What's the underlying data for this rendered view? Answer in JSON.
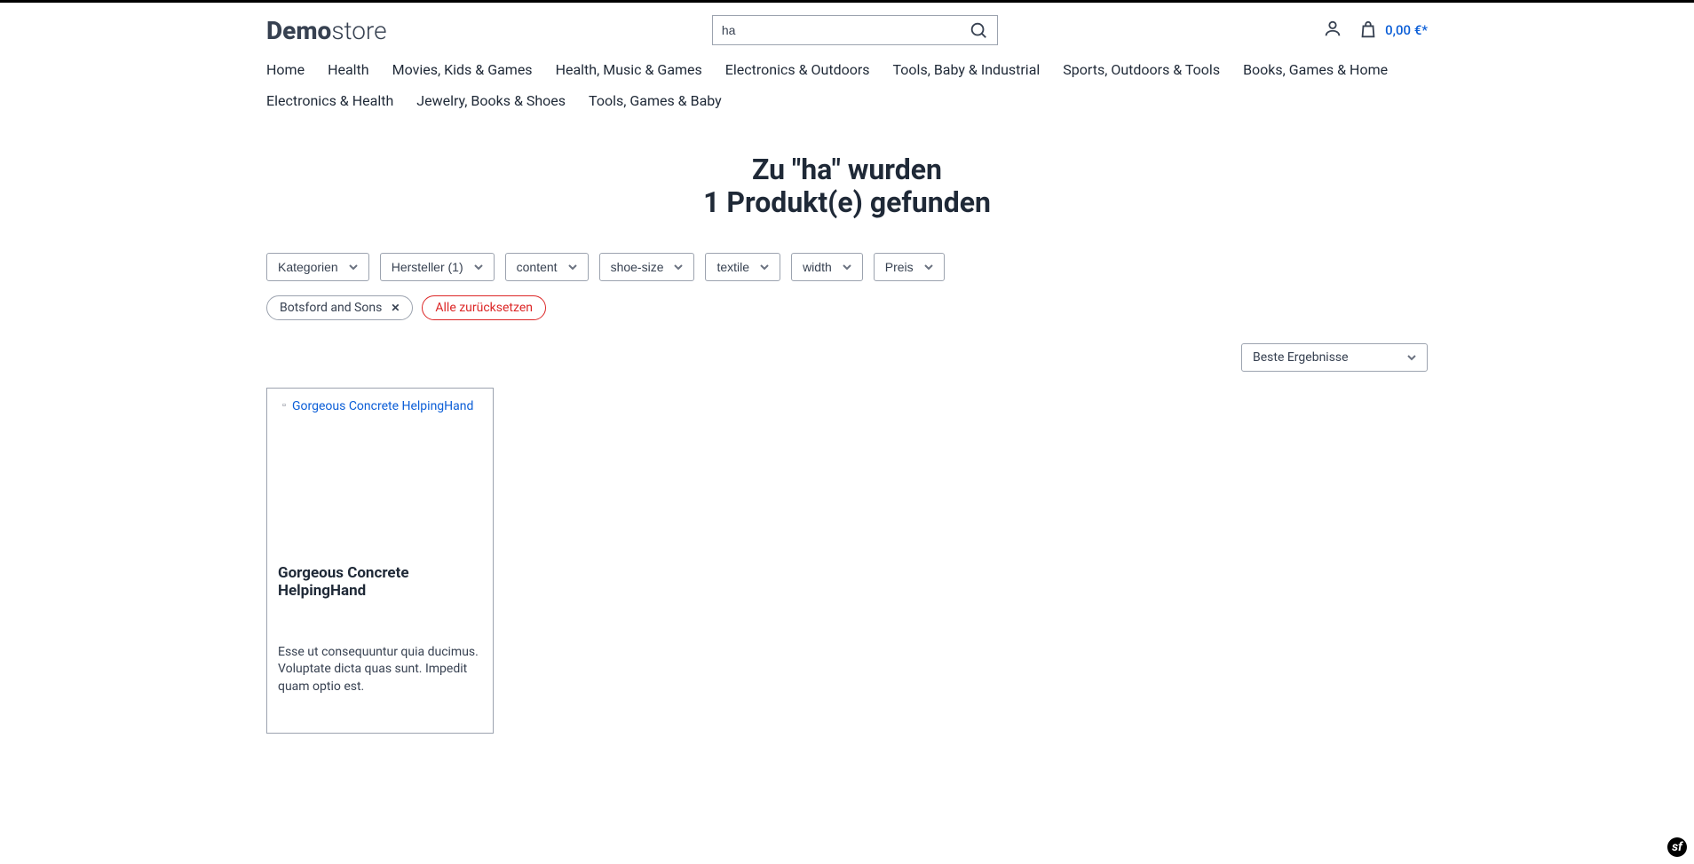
{
  "logo": {
    "bold": "Demo",
    "light": "store"
  },
  "search": {
    "value": "ha"
  },
  "cart": {
    "total": "0,00 €*"
  },
  "nav": [
    "Home",
    "Health",
    "Movies, Kids & Games",
    "Health, Music & Games",
    "Electronics & Outdoors",
    "Tools, Baby & Industrial",
    "Sports, Outdoors & Tools",
    "Books, Games & Home",
    "Electronics & Health",
    "Jewelry, Books & Shoes",
    "Tools, Games & Baby"
  ],
  "title_line1": "Zu \"ha\" wurden",
  "title_line2": "1 Produkt(e) gefunden",
  "filters": [
    {
      "label": "Kategorien",
      "count": ""
    },
    {
      "label": "Hersteller",
      "count": "(1)"
    },
    {
      "label": "content",
      "count": ""
    },
    {
      "label": "shoe-size",
      "count": ""
    },
    {
      "label": "textile",
      "count": ""
    },
    {
      "label": "width",
      "count": ""
    },
    {
      "label": "Preis",
      "count": ""
    }
  ],
  "active_filters": {
    "chip_label": "Botsford and Sons",
    "reset_label": "Alle zurücksetzen"
  },
  "sort": {
    "selected": "Beste Ergebnisse"
  },
  "product": {
    "img_alt": "Gorgeous Concrete HelpingHand",
    "title": "Gorgeous Concrete HelpingHand",
    "desc": "Esse ut consequuntur quia ducimus. Voluptate dicta quas sunt. Impedit quam optio est."
  },
  "sf_badge": "sf"
}
